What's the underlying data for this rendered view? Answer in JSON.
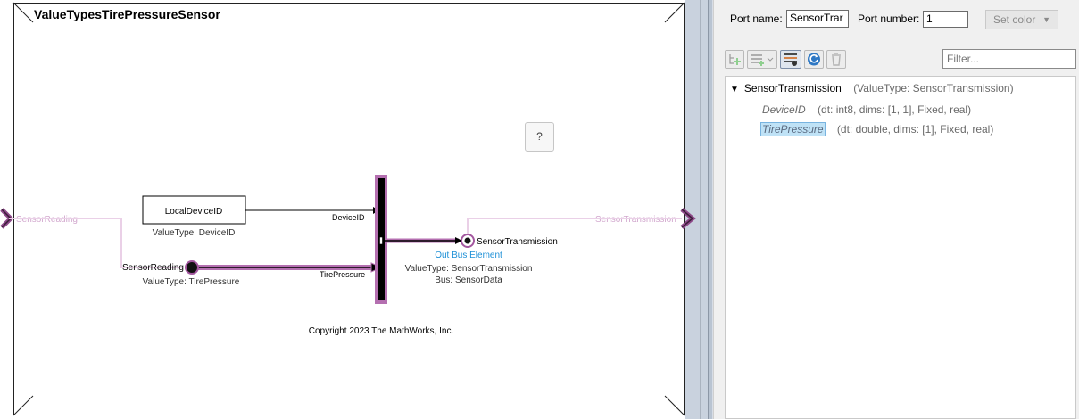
{
  "model": {
    "title": "ValueTypesTirePressureSensor",
    "help_label": "?",
    "copyright": "Copyright 2023 The MathWorks, Inc.",
    "blocks": {
      "local_device_id": "LocalDeviceID",
      "local_device_id_value_type": "ValueType: DeviceID",
      "sensor_reading_in": "SensorReading",
      "sensor_reading_value_type": "ValueType: TirePressure",
      "sensor_transmission_out": "SensorTransmission",
      "out_bus_element": "Out Bus Element",
      "sensor_transmission_value_type": "ValueType: SensorTransmission",
      "sensor_transmission_bus": "Bus: SensorData"
    },
    "signals": {
      "device_id": "DeviceID",
      "tire_pressure": "TirePressure",
      "left_port_label": "SensorReading",
      "right_port_label": "SensorTransmission"
    },
    "colors": {
      "port_highlight": "#a3579f",
      "signal_faint": "#e8c8e4",
      "link_blue": "#1c8fd6"
    }
  },
  "panel": {
    "port_name_label": "Port name:",
    "port_name_value": "SensorTrar",
    "port_number_label": "Port number:",
    "port_number_value": "1",
    "set_color_label": "Set color",
    "filter_placeholder": "Filter...",
    "toolbar": [
      {
        "icon": "add-element-icon",
        "enabled": false
      },
      {
        "icon": "add-list-icon",
        "enabled": false
      },
      {
        "icon": "bus-editor-icon",
        "enabled": true
      },
      {
        "icon": "refresh-icon",
        "enabled": true
      },
      {
        "icon": "delete-icon",
        "enabled": false
      }
    ],
    "tree": {
      "root_name": "SensorTransmission",
      "root_meta": "(ValueType: SensorTransmission)",
      "children": [
        {
          "name": "DeviceID",
          "meta": "(dt: int8, dims: [1, 1], Fixed, real)",
          "selected": false
        },
        {
          "name": "TirePressure",
          "meta": "(dt: double, dims: [1], Fixed, real)",
          "selected": true
        }
      ]
    }
  }
}
